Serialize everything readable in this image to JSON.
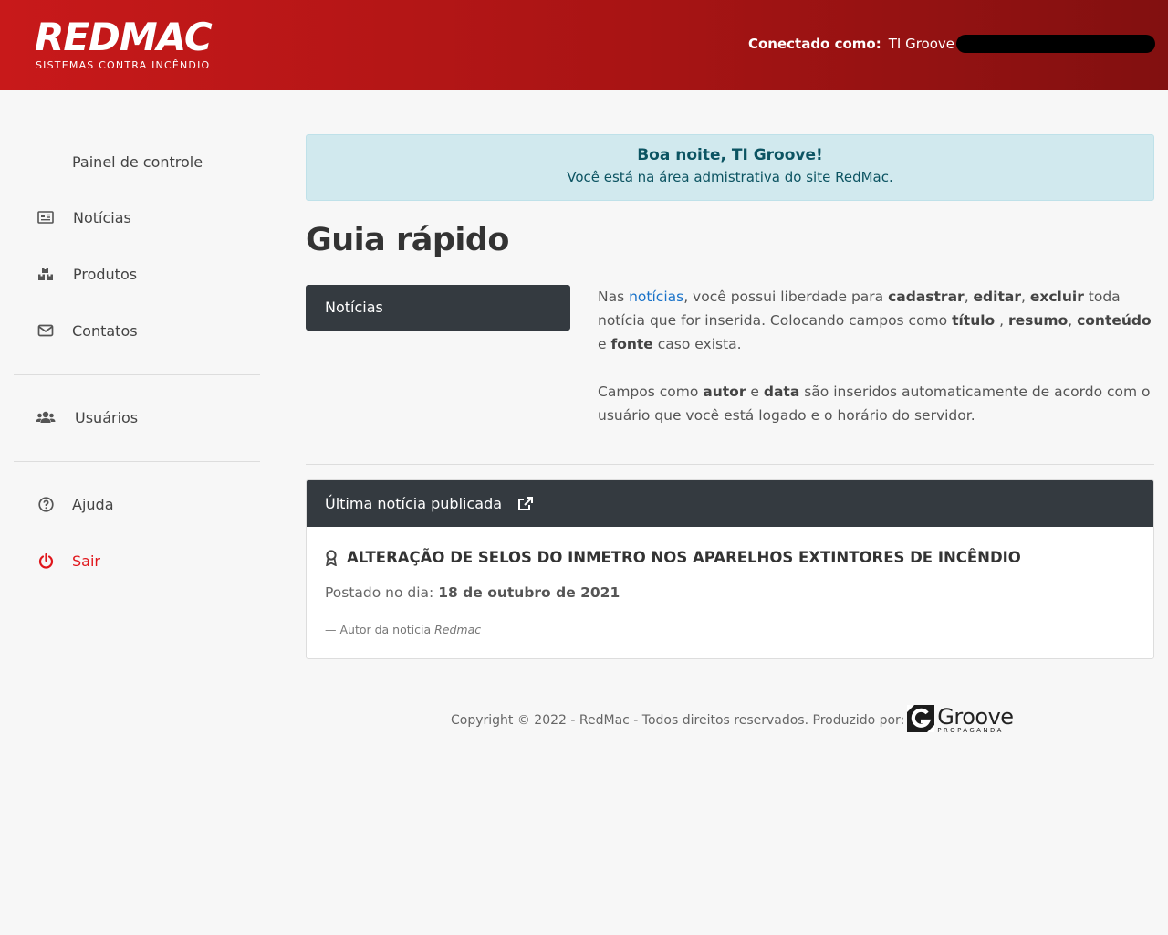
{
  "header": {
    "logo_word": "REDMAC",
    "logo_sub": "SISTEMAS CONTRA INCÊNDIO",
    "connected_label": "Conectado como:",
    "connected_user": "TI Groove",
    "gradient": [
      "#c8191a",
      "#821010"
    ]
  },
  "sidebar": {
    "items": [
      {
        "label": "Painel de controle",
        "icon": "none"
      },
      {
        "label": "Notícias",
        "icon": "newspaper-icon"
      },
      {
        "label": "Produtos",
        "icon": "boxes-icon"
      },
      {
        "label": "Contatos",
        "icon": "envelope-icon"
      },
      {
        "label": "Usuários",
        "icon": "users-icon"
      },
      {
        "label": "Ajuda",
        "icon": "question-circle-icon"
      },
      {
        "label": "Sair",
        "icon": "power-icon",
        "color": "#e0161b"
      }
    ]
  },
  "alert": {
    "title": "Boa noite, TI Groove!",
    "text": "Você está na área admistrativa do site RedMac."
  },
  "guide": {
    "title": "Guia rápido",
    "tab_label": "Notícias",
    "p1": {
      "t1": "Nas ",
      "link": "notícias",
      "t2": ", você possui liberdade para ",
      "b1": "cadastrar",
      "t3": ", ",
      "b2": "editar",
      "t4": ", ",
      "b3": "excluir",
      "t5": " toda notícia que for inserida. Colocando campos como ",
      "b4": "título",
      "t6": " , ",
      "b5": "resumo",
      "t7": ", ",
      "b6": "conteúdo",
      "t8": " e ",
      "b7": "fonte",
      "t9": " caso exista."
    },
    "p2": {
      "t1": "Campos como ",
      "b1": "autor",
      "t2": " e ",
      "b2": "data",
      "t3": " são inseridos automaticamente de acordo com o usuário que você está logado e o horário do servidor."
    }
  },
  "last_news": {
    "header": "Última notícia publicada",
    "title": "ALTERAÇÃO DE SELOS DO INMETRO NOS APARELHOS EXTINTORES DE INCÊNDIO",
    "posted_label": "Postado no dia: ",
    "posted_date": "18 de outubro de 2021",
    "author_prefix": "— Autor da notícia ",
    "author": "Redmac"
  },
  "footer": {
    "text": "Copyright © 2022 - RedMac - Todos direitos reservados. Produzido por:",
    "brand": "Groove",
    "brand_sub": "PROPAGANDA"
  }
}
